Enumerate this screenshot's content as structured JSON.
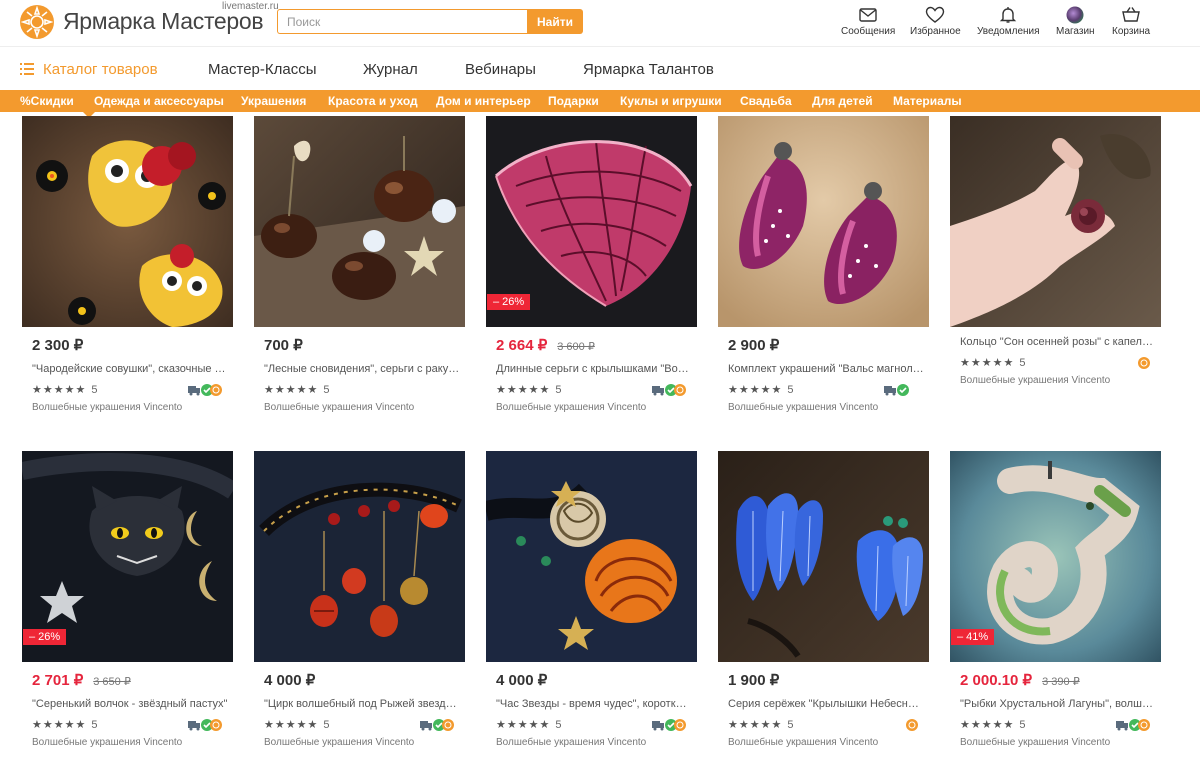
{
  "header": {
    "brand": "Ярмарка Мастеров",
    "brand_sub": "livemaster.ru",
    "search_placeholder": "Поиск",
    "search_button": "Найти",
    "nav": [
      {
        "label": "Сообщения",
        "icon": "envelope-icon"
      },
      {
        "label": "Избранное",
        "icon": "heart-icon"
      },
      {
        "label": "Уведомления",
        "icon": "bell-icon"
      },
      {
        "label": "Магазин",
        "icon": "shop-avatar-icon"
      },
      {
        "label": "Корзина",
        "icon": "basket-icon"
      }
    ]
  },
  "mainnav": {
    "catalog": "Каталог товаров",
    "items": [
      "Мастер-Классы",
      "Журнал",
      "Вебинары",
      "Ярмарка Талантов"
    ]
  },
  "categories": [
    "%Скидки",
    "Одежда и аксессуары",
    "Украшения",
    "Красота и уход",
    "Дом и интерьер",
    "Подарки",
    "Куклы и игрушки",
    "Свадьба",
    "Для детей",
    "Материалы"
  ],
  "colors": {
    "accent": "#f39a2e",
    "sale": "#e5253d",
    "badge": "#ef2636"
  },
  "products": [
    {
      "price": "2 300 ₽",
      "old_price": "",
      "discount": "",
      "title": "\"Чародейские совушки\", сказочные серьги",
      "rating_stars": "★★★★★",
      "rating": "5",
      "seller": "Волшебные украшения Vincento"
    },
    {
      "price": "700 ₽",
      "old_price": "",
      "discount": "",
      "title": "\"Лесные сновидения\", серьги с ракушками",
      "rating_stars": "★★★★★",
      "rating": "5",
      "seller": "Волшебные украшения Vincento"
    },
    {
      "price": "2 664 ₽",
      "old_price": "3 600 ₽",
      "discount": "– 26%",
      "title": "Длинные серьги с крылышками \"Восход\"",
      "rating_stars": "★★★★★",
      "rating": "5",
      "seller": "Волшебные украшения Vincento"
    },
    {
      "price": "2 900 ₽",
      "old_price": "",
      "discount": "",
      "title": "Комплект украшений \"Вальс магнолий\"",
      "rating_stars": "★★★★★",
      "rating": "5",
      "seller": "Волшебные украшения Vincento"
    },
    {
      "price": "",
      "old_price": "",
      "discount": "",
      "title": "Кольцо \"Сон осенней розы\" с капелькой",
      "rating_stars": "★★★★★",
      "rating": "5",
      "seller": "Волшебные украшения Vincento"
    },
    {
      "price": "2 701 ₽",
      "old_price": "3 650 ₽",
      "discount": "– 26%",
      "title": "\"Серенький волчок - звёздный пастух\"",
      "rating_stars": "★★★★★",
      "rating": "5",
      "seller": "Волшебные украшения Vincento"
    },
    {
      "price": "4 000 ₽",
      "old_price": "",
      "discount": "",
      "title": "\"Цирк волшебный под Рыжей звездой\"",
      "rating_stars": "★★★★★",
      "rating": "5",
      "seller": "Волшебные украшения Vincento"
    },
    {
      "price": "4 000 ₽",
      "old_price": "",
      "discount": "",
      "title": "\"Час Звезды - время чудес\", короткое колье",
      "rating_stars": "★★★★★",
      "rating": "5",
      "seller": "Волшебные украшения Vincento"
    },
    {
      "price": "1 900 ₽",
      "old_price": "",
      "discount": "",
      "title": "Серия серёжек \"Крылышки Небесные\"",
      "rating_stars": "★★★★★",
      "rating": "5",
      "seller": "Волшебные украшения Vincento"
    },
    {
      "price": "2 000.10 ₽",
      "old_price": "3 390 ₽",
      "discount": "– 41%",
      "title": "\"Рыбки Хрустальной Лагуны\", волшебный кулон",
      "rating_stars": "★★★★★",
      "rating": "5",
      "seller": "Волшебные украшения Vincento"
    }
  ]
}
